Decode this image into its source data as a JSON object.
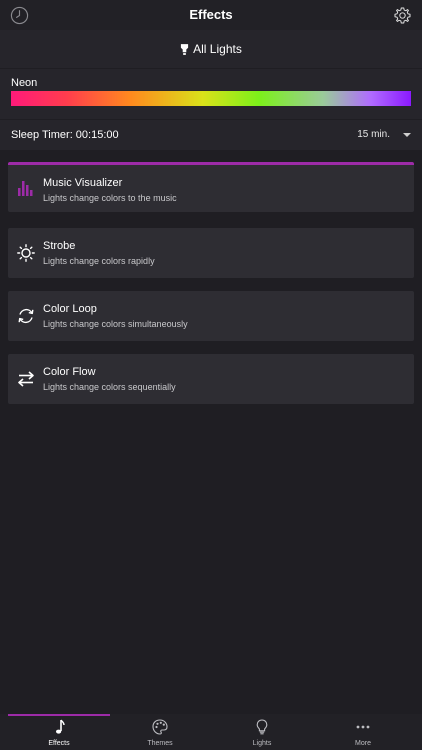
{
  "header": {
    "title": "Effects",
    "left_icon": "clock-icon",
    "right_icon": "gear-icon"
  },
  "group": {
    "label": "All Lights",
    "icon": "bulb-icon"
  },
  "neon": {
    "label": "Neon",
    "gradient_colors": [
      "#ff1a7a",
      "#ff3d4d",
      "#ff8a1e",
      "#d9e21a",
      "#7cf01a",
      "#9acb9a",
      "#b06bff",
      "#8b1aff"
    ]
  },
  "sleep": {
    "label": "Sleep Timer: 00:15:00",
    "value": "15 min."
  },
  "effects": [
    {
      "title": "Music Visualizer",
      "subtitle": "Lights change colors to the music",
      "icon": "equalizer-icon",
      "active": true
    },
    {
      "title": "Strobe",
      "subtitle": "Lights change colors rapidly",
      "icon": "sun-icon",
      "active": false
    },
    {
      "title": "Color Loop",
      "subtitle": "Lights change colors simultaneously",
      "icon": "loop-icon",
      "active": false
    },
    {
      "title": "Color Flow",
      "subtitle": "Lights change colors sequentially",
      "icon": "flow-arrows-icon",
      "active": false
    }
  ],
  "tabs": [
    {
      "label": "Effects",
      "icon": "music-note-icon",
      "active": true
    },
    {
      "label": "Themes",
      "icon": "palette-icon",
      "active": false
    },
    {
      "label": "Lights",
      "icon": "lightbulb-icon",
      "active": false
    },
    {
      "label": "More",
      "icon": "more-dots-icon",
      "active": false
    }
  ],
  "colors": {
    "accent": "#9d2ba8",
    "background": "#1f1e23",
    "card": "#2e2d33"
  }
}
